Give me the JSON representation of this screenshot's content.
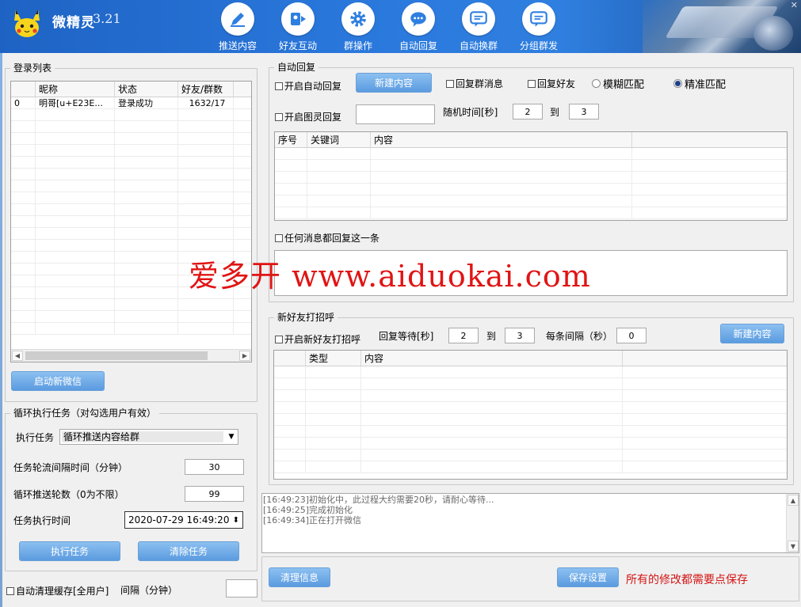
{
  "app": {
    "title": "微精灵",
    "version": "3.21"
  },
  "nav": [
    {
      "label": "推送内容",
      "icon": "pen-icon"
    },
    {
      "label": "好友互动",
      "icon": "chat-friend-icon"
    },
    {
      "label": "群操作",
      "icon": "gear-icon"
    },
    {
      "label": "自动回复",
      "icon": "speech-bubble-icon"
    },
    {
      "label": "自动换群",
      "icon": "chat-switch-icon"
    },
    {
      "label": "分组群发",
      "icon": "group-send-icon"
    }
  ],
  "login": {
    "title": "登录列表",
    "columns": [
      "昵称",
      "状态",
      "好友/群数"
    ],
    "rows": [
      {
        "index": "0",
        "nickname": "明哥[u+E23E...",
        "status": "登录成功",
        "counts": "1632/17"
      }
    ],
    "start_button": "启动新微信"
  },
  "loop_task": {
    "title": "循环执行任务（对勾选用户有效）",
    "task_label": "执行任务",
    "task_value": "循环推送内容给群",
    "interval_label": "任务轮流间隔时间（分钟）",
    "interval_value": "30",
    "rounds_label": "循环推送轮数（0为不限）",
    "rounds_value": "99",
    "time_label": "任务执行时间",
    "time_value": "2020-07-29 16:49:20",
    "run_button": "执行任务",
    "clear_button": "清除任务"
  },
  "cache": {
    "label": "自动清理缓存[全用户]",
    "interval_label": "间隔（分钟）",
    "value": ""
  },
  "auto_reply": {
    "title": "自动回复",
    "enable_label": "开启自动回复",
    "new_button": "新建内容",
    "reply_group_label": "回复群消息",
    "reply_friend_label": "回复好友",
    "fuzzy_label": "模糊匹配",
    "exact_label": "精准匹配",
    "turing_label": "开启图灵回复",
    "turing_value": "",
    "random_label": "随机时间[秒]",
    "random_from": "2",
    "to_label": "到",
    "random_to": "3",
    "columns": [
      "序号",
      "关键词",
      "内容"
    ],
    "any_label": "任何消息都回复这一条",
    "any_text": ""
  },
  "greet": {
    "title": "新好友打招呼",
    "enable_label": "开启新好友打招呼",
    "wait_label": "回复等待[秒]",
    "wait_from": "2",
    "to_label": "到",
    "wait_to": "3",
    "gap_label": "每条间隔（秒）",
    "gap_value": "0",
    "new_button": "新建内容",
    "columns": [
      "类型",
      "内容"
    ]
  },
  "log": {
    "lines": [
      "[16:49:23]初始化中，此过程大约需要20秒，请耐心等待...",
      "[16:49:25]完成初始化",
      "[16:49:34]正在打开微信"
    ]
  },
  "footer": {
    "clear_button": "清理信息",
    "save_button": "保存设置",
    "save_note": "所有的修改都需要点保存"
  },
  "watermark": "爱多开 www.aiduokai.com"
}
